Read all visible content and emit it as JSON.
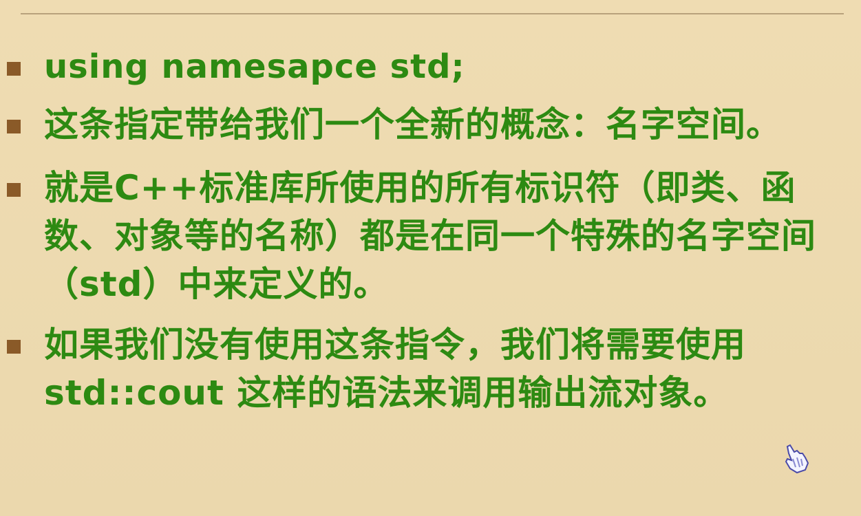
{
  "slide": {
    "bullets": [
      {
        "text": "using namesapce std;"
      },
      {
        "text": "这条指定带给我们一个全新的概念：名字空间。"
      },
      {
        "text": "就是C++标准库所使用的所有标识符（即类、函数、对象等的名称）都是在同一个特殊的名字空间（std）中来定义的。"
      },
      {
        "text": "如果我们没有使用这条指令，我们将需要使用std::cout 这样的语法来调用输出流对象。"
      }
    ]
  },
  "colors": {
    "background": "#ecd9ae",
    "text": "#2d8a12",
    "bullet_marker": "#8a5a28",
    "rule": "#b8a27c"
  },
  "icons": {
    "cursor": "hand-pointer-icon"
  }
}
